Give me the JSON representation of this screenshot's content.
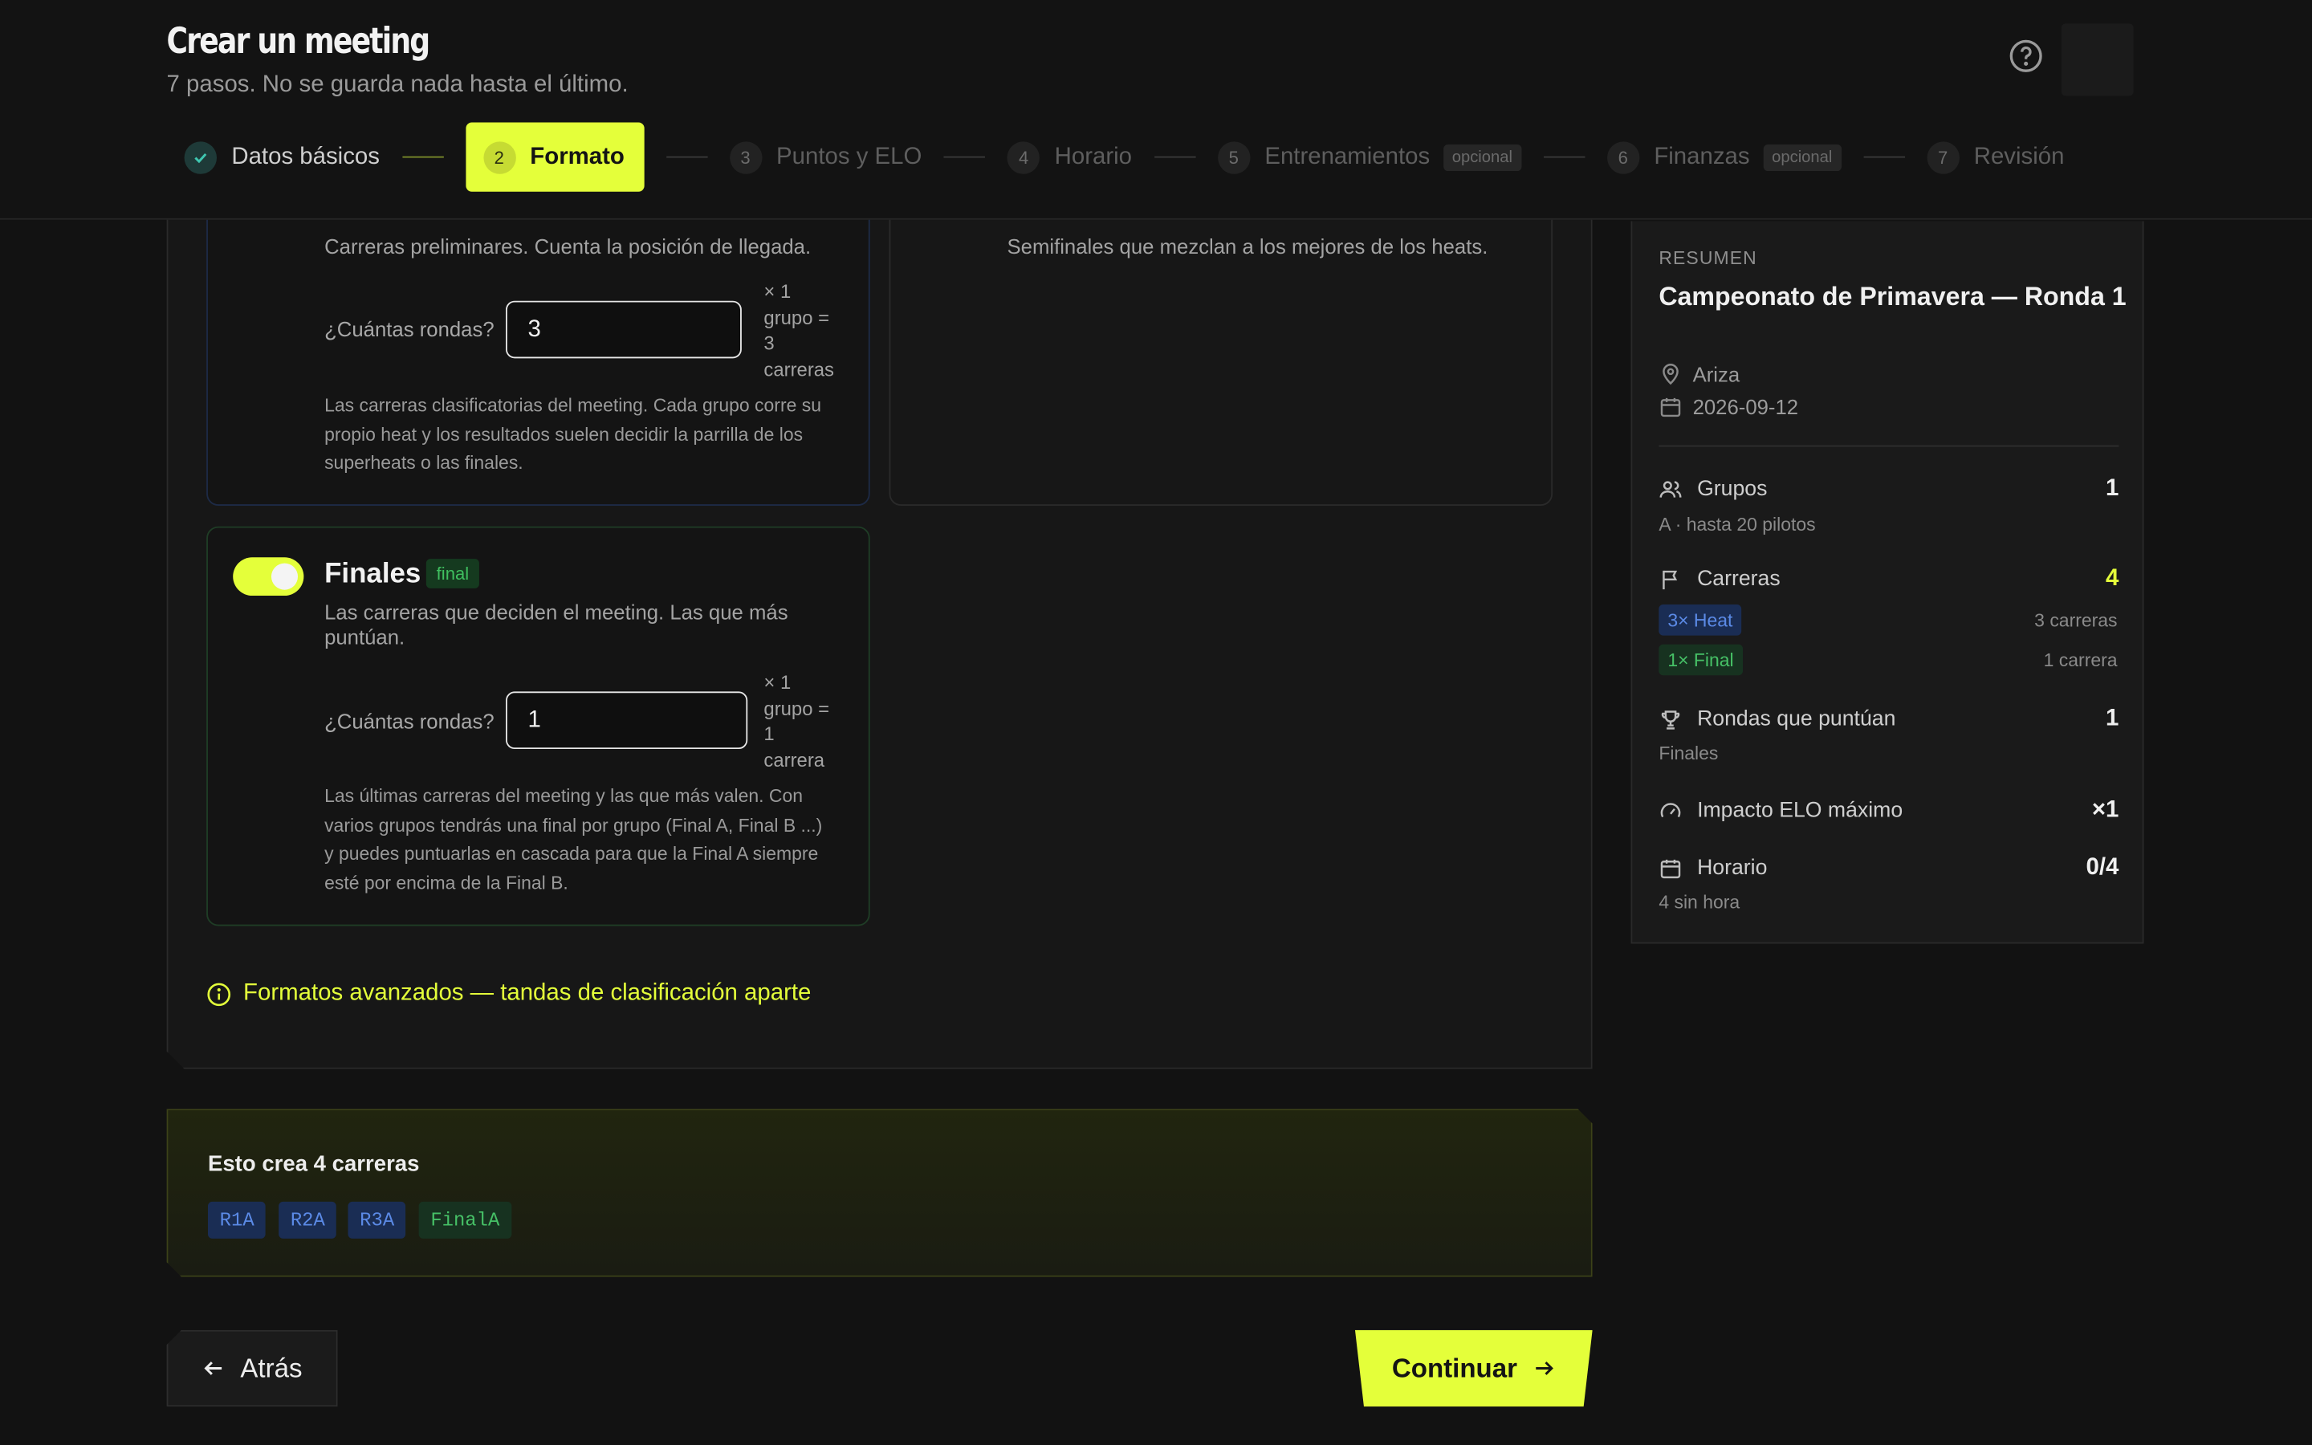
{
  "header": {
    "title": "Crear un meeting",
    "subtitle": "7 pasos. No se guarda nada hasta el último."
  },
  "stepper": [
    {
      "num": "",
      "label": "Datos básicos",
      "state": "done"
    },
    {
      "num": "2",
      "label": "Formato",
      "state": "active"
    },
    {
      "num": "3",
      "label": "Puntos y ELO",
      "state": "pending"
    },
    {
      "num": "4",
      "label": "Horario",
      "state": "pending"
    },
    {
      "num": "5",
      "label": "Entrenamientos",
      "state": "pending",
      "badge": "opcional"
    },
    {
      "num": "6",
      "label": "Finanzas",
      "state": "pending",
      "badge": "opcional"
    },
    {
      "num": "7",
      "label": "Revisión",
      "state": "pending"
    }
  ],
  "cards": {
    "heats": {
      "desc": "Carreras preliminares. Cuenta la posición de llegada.",
      "rounds_label": "¿Cuántas rondas?",
      "rounds_value": "3",
      "calc": [
        "× 1",
        "grupo =",
        "3",
        "carreras"
      ],
      "long_desc": [
        "Las carreras clasificatorias del meeting. Cada grupo corre su",
        "propio heat y los resultados suelen decidir la parrilla de los",
        "superheats o las finales."
      ],
      "enabled": true
    },
    "superheats": {
      "desc": "Semifinales que mezclan a los mejores de los heats.",
      "enabled": false
    },
    "finals": {
      "title": "Finales",
      "tag": "final",
      "desc": [
        "Las carreras que deciden el meeting. Las que más",
        "puntúan."
      ],
      "rounds_label": "¿Cuántas rondas?",
      "rounds_value": "1",
      "calc": [
        "× 1",
        "grupo =",
        "1",
        "carrera"
      ],
      "long_desc": [
        "Las últimas carreras del meeting y las que más valen. Con",
        "varios grupos tendrás una final por grupo (Final A, Final B ...)",
        "y puedes puntuarlas en cascada para que la Final A siempre",
        "esté por encima de la Final B."
      ],
      "enabled": true
    }
  },
  "advanced_link": "Formatos avanzados — tandas de clasificación aparte",
  "creates": {
    "title": "Esto crea 4 carreras",
    "chips": [
      {
        "label": "R1A",
        "color": "blue"
      },
      {
        "label": "R2A",
        "color": "blue"
      },
      {
        "label": "R3A",
        "color": "blue"
      },
      {
        "label": "FinalA",
        "color": "green"
      }
    ]
  },
  "buttons": {
    "back": "Atrás",
    "next": "Continuar"
  },
  "summary": {
    "eyebrow": "RESUMEN",
    "title": "Campeonato de Primavera — Ronda 1",
    "location": "Ariza",
    "date": "2026-09-12",
    "groups_label": "Grupos",
    "groups_value": "1",
    "groups_sub": "A · hasta 20 pilotos",
    "races_label": "Carreras",
    "races_value": "4",
    "race_chips": [
      {
        "label": "3× Heat",
        "count": "3 carreras"
      },
      {
        "label": "1× Final",
        "count": "1 carrera"
      }
    ],
    "scoring_label": "Rondas que puntúan",
    "scoring_value": "1",
    "scoring_sub": "Finales",
    "elo_label": "Impacto ELO máximo",
    "elo_value": "×1",
    "schedule_label": "Horario",
    "schedule_value": "0/4",
    "schedule_sub": "4 sin hora"
  },
  "colors": {
    "accent": "#e4ff3a",
    "background": "#121212",
    "blue_chip": "#5b8ae6",
    "green_chip": "#46c066"
  }
}
